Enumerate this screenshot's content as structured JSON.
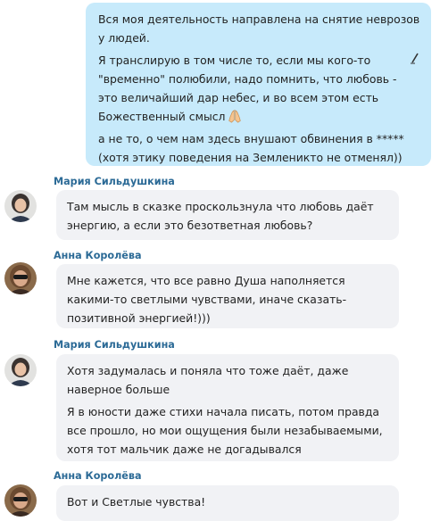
{
  "outgoing": {
    "p1": [
      "Вся моя деятельность направлена на снятие неврозов",
      "у людей."
    ],
    "p2": [
      "Я транслирую в том числе то, если мы кого-то",
      "\"временно\" полюбили, надо помнить, что любовь -",
      "это величайший дар небес, и во всем этом есть",
      "Божественный смысл"
    ],
    "p3": [
      "а не то, о чем нам здесь внушают обвинения в *****",
      "(хотя этику поведения на Земленикто не отменял))"
    ],
    "edit_icon": "edit-pencil-icon",
    "emoji": "praying-hands-emoji"
  },
  "messages": [
    {
      "sender": "Мария Сильдушкина",
      "paragraphs": [
        [
          "Там мысль в сказке проскользнула что любовь даёт",
          "энергию, а если это безответная любовь?"
        ]
      ]
    },
    {
      "sender": "Анна Королёва",
      "paragraphs": [
        [
          "Мне кажется, что все равно Душа наполняется",
          "какими-то светлыми чувствами, иначе сказать-",
          "позитивной энергией!)))"
        ]
      ]
    },
    {
      "sender": "Мария Сильдушкина",
      "paragraphs": [
        [
          "Хотя задумалась и поняла что тоже даёт, даже",
          "наверное больше"
        ],
        [
          "Я в юности даже стихи начала писать, потом правда",
          "все прошло, но мои ощущения были незабываемыми,",
          "хотя тот мальчик даже не догадывался"
        ]
      ]
    },
    {
      "sender": "Анна Королёва",
      "paragraphs": [
        [
          "Вот и Светлые чувства!"
        ]
      ]
    }
  ],
  "colors": {
    "outgoing_bubble": "#c7eafb",
    "incoming_bubble": "#f1f2f5",
    "sender_name": "#2b6a96"
  }
}
